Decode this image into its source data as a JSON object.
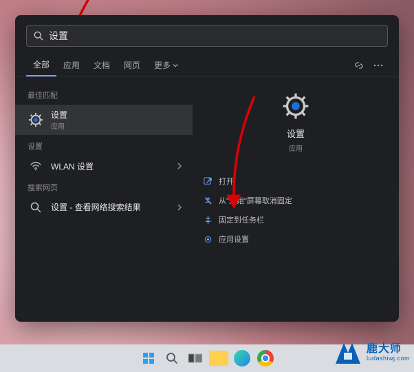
{
  "search": {
    "query": "设置"
  },
  "tabs": {
    "all": "全部",
    "apps": "应用",
    "docs": "文档",
    "web": "网页",
    "more": "更多"
  },
  "left": {
    "best_match_label": "最佳匹配",
    "best_match": {
      "title": "设置",
      "sub": "应用"
    },
    "settings_label": "设置",
    "wlan": {
      "title": "WLAN 设置"
    },
    "web_label": "搜索网页",
    "web_item": {
      "title": "设置 - 查看网络搜索结果"
    }
  },
  "right": {
    "app_title": "设置",
    "app_sub": "应用",
    "actions": {
      "open": "打开",
      "unpin_start": "从\"开始\"屏幕取消固定",
      "pin_taskbar": "固定到任务栏",
      "app_settings": "应用设置"
    }
  },
  "watermark": {
    "name": "鹿大师",
    "domain": "ludashiwj.com"
  }
}
